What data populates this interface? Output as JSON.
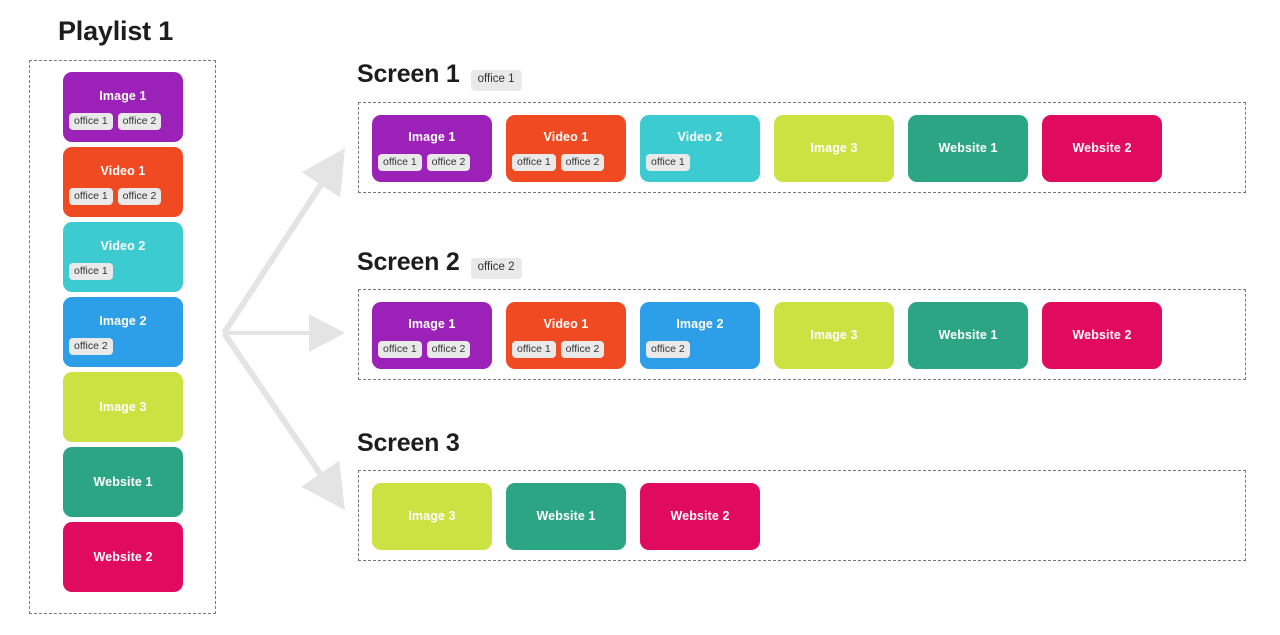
{
  "playlist": {
    "title": "Playlist 1",
    "items": [
      {
        "label": "Image 1",
        "color": "#9c21b8",
        "tags": [
          "office 1",
          "office 2"
        ]
      },
      {
        "label": "Video 1",
        "color": "#f04a23",
        "tags": [
          "office 1",
          "office 2"
        ]
      },
      {
        "label": "Video 2",
        "color": "#3ccbd1",
        "tags": [
          "office 1"
        ]
      },
      {
        "label": "Image 2",
        "color": "#2d9fe8",
        "tags": [
          "office 2"
        ]
      },
      {
        "label": "Image 3",
        "color": "#cbe243",
        "tags": []
      },
      {
        "label": "Website 1",
        "color": "#2ca585",
        "tags": []
      },
      {
        "label": "Website 2",
        "color": "#e00a5e",
        "tags": []
      }
    ]
  },
  "screens": [
    {
      "title": "Screen 1",
      "badge": "office 1",
      "items": [
        {
          "label": "Image 1",
          "color": "#9c21b8",
          "tags": [
            "office 1",
            "office 2"
          ]
        },
        {
          "label": "Video 1",
          "color": "#f04a23",
          "tags": [
            "office 1",
            "office 2"
          ]
        },
        {
          "label": "Video 2",
          "color": "#3ccbd1",
          "tags": [
            "office 1"
          ]
        },
        {
          "label": "Image 3",
          "color": "#cbe243",
          "tags": []
        },
        {
          "label": "Website 1",
          "color": "#2ca585",
          "tags": []
        },
        {
          "label": "Website 2",
          "color": "#e00a5e",
          "tags": []
        }
      ]
    },
    {
      "title": "Screen 2",
      "badge": "office 2",
      "items": [
        {
          "label": "Image 1",
          "color": "#9c21b8",
          "tags": [
            "office 1",
            "office 2"
          ]
        },
        {
          "label": "Video 1",
          "color": "#f04a23",
          "tags": [
            "office 1",
            "office 2"
          ]
        },
        {
          "label": "Image 2",
          "color": "#2d9fe8",
          "tags": [
            "office 2"
          ]
        },
        {
          "label": "Image 3",
          "color": "#cbe243",
          "tags": []
        },
        {
          "label": "Website 1",
          "color": "#2ca585",
          "tags": []
        },
        {
          "label": "Website 2",
          "color": "#e00a5e",
          "tags": []
        }
      ]
    },
    {
      "title": "Screen 3",
      "badge": "",
      "items": [
        {
          "label": "Image 3",
          "color": "#cbe243",
          "tags": []
        },
        {
          "label": "Website 1",
          "color": "#2ca585",
          "tags": []
        },
        {
          "label": "Website 2",
          "color": "#e00a5e",
          "tags": []
        }
      ]
    }
  ],
  "arrows": {
    "color": "#e4e4e4",
    "count": 3,
    "origin_label": "playlist-fanout-origin"
  },
  "style": {
    "dash_border": "#7a7a7a",
    "tag_background": "#e9e9e9",
    "tag_text": "#333333",
    "heading_text": "#1d1d1d"
  }
}
